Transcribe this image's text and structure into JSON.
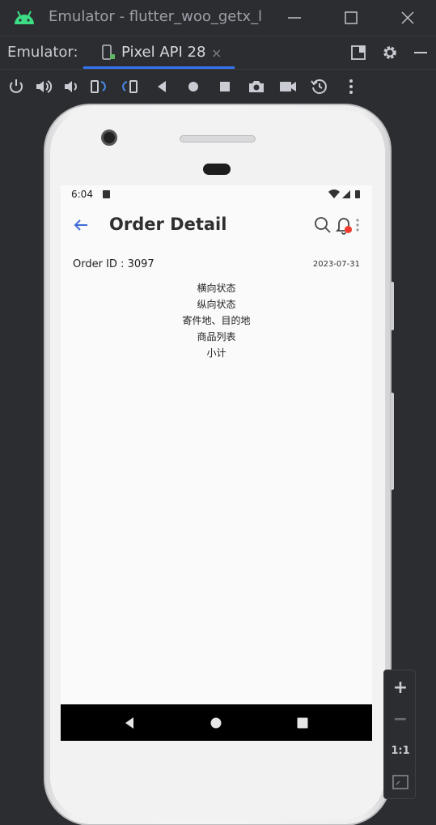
{
  "window": {
    "title": "Emulator - flutter_woo_getx_le"
  },
  "tabbar": {
    "label": "Emulator:",
    "device_tab": "Pixel API 28",
    "close_glyph": "×"
  },
  "zoom": {
    "plus": "+",
    "minus": "−",
    "actual_size": "1:1"
  },
  "device": {
    "status": {
      "time": "6:04"
    },
    "appbar": {
      "title": "Order Detail"
    },
    "order": {
      "id_label": "Order ID : 3097",
      "date": "2023-07-31"
    },
    "sections": [
      "横向状态",
      "纵向状态",
      "寄件地、目的地",
      "商品列表",
      "小计"
    ]
  },
  "colors": {
    "ide_bg": "#2b2d30",
    "accent": "#3574f0",
    "back_arrow": "#3f6bd6",
    "badge": "#f23b2f",
    "android_green": "#3ddc84"
  }
}
